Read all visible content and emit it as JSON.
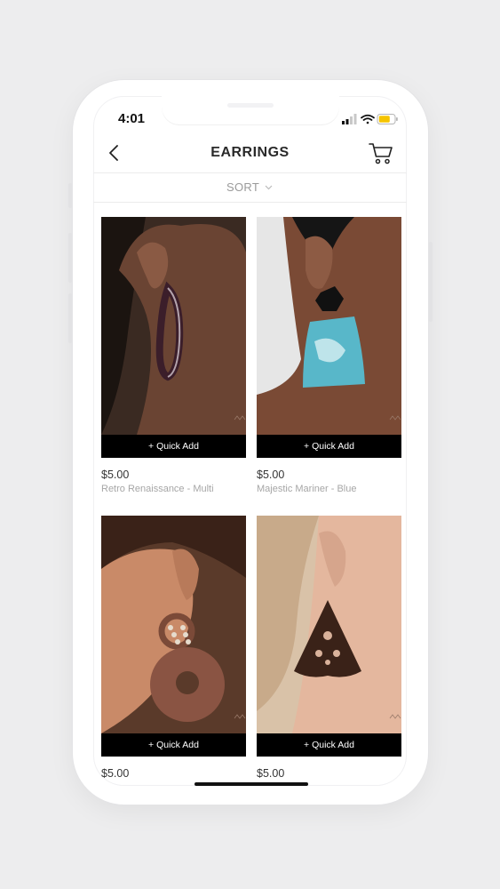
{
  "status": {
    "time": "4:01"
  },
  "header": {
    "title": "EARRINGS"
  },
  "sort": {
    "label": "SORT"
  },
  "products": [
    {
      "price": "$5.00",
      "name": "Retro Renaissance - Multi",
      "quick_add": "+ Quick Add"
    },
    {
      "price": "$5.00",
      "name": "Majestic Mariner - Blue",
      "quick_add": "+ Quick Add"
    },
    {
      "price": "$5.00",
      "name": "",
      "quick_add": "+ Quick Add"
    },
    {
      "price": "$5.00",
      "name": "",
      "quick_add": "+ Quick Add"
    }
  ],
  "colors": {
    "accent": "#000000",
    "battery": "#f5c400",
    "background": "#ededee"
  },
  "icons": [
    "back-chevron-icon",
    "cart-icon",
    "chevron-down-icon",
    "signal-icon",
    "wifi-icon",
    "battery-icon"
  ]
}
